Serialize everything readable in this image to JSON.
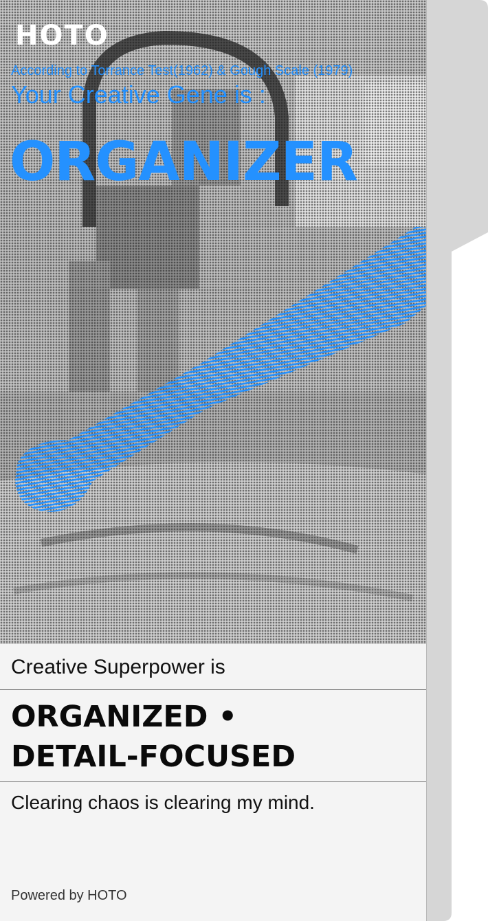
{
  "brand": {
    "logo_text": "HOTO"
  },
  "result": {
    "citation": "According to Torrance Test(1962) & Gough Scale (1979)",
    "gene_prefix": "Your Creative Gene is :",
    "type": "ORGANIZER"
  },
  "superpower": {
    "label": "Creative Superpower is",
    "line1": "ORGANIZED •",
    "line2": "DETAIL-FOCUSED",
    "quote": "Clearing chaos is clearing my mind."
  },
  "footer": {
    "powered_by": "Powered by HOTO"
  },
  "colors": {
    "accent_blue": "#2491ff",
    "panel_bg": "#f4f4f4",
    "side_tab": "#d6d6d6",
    "text_dark": "#111111"
  },
  "icons": {
    "decorative_stroke": "blue-brush-stroke"
  }
}
